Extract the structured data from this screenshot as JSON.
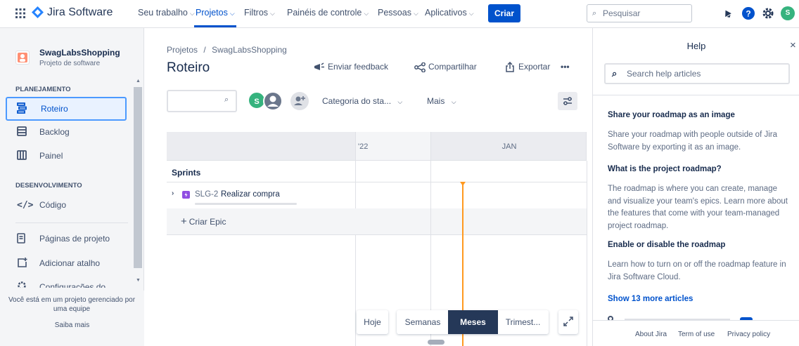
{
  "topnav": {
    "brand": "Jira Software",
    "items": [
      {
        "label": "Seu trabalho"
      },
      {
        "label": "Projetos"
      },
      {
        "label": "Filtros"
      },
      {
        "label": "Painéis de controle"
      },
      {
        "label": "Pessoas"
      },
      {
        "label": "Aplicativos"
      }
    ],
    "create_label": "Criar",
    "search_placeholder": "Pesquisar",
    "avatar_initial": "S",
    "accent": "#0052cc"
  },
  "sidebar": {
    "project_name": "SwagLabsShopping",
    "project_type": "Projeto de software",
    "section_planning": "PLANEJAMENTO",
    "planning_items": [
      {
        "label": "Roteiro",
        "icon": "roadmap-icon",
        "selected": true
      },
      {
        "label": "Backlog",
        "icon": "backlog-icon"
      },
      {
        "label": "Painel",
        "icon": "board-icon"
      }
    ],
    "section_dev": "DESENVOLVIMENTO",
    "dev_items": [
      {
        "label": "Código",
        "icon": "code-icon"
      }
    ],
    "other_items": [
      {
        "label": "Páginas de projeto",
        "icon": "pages-icon"
      },
      {
        "label": "Adicionar atalho",
        "icon": "add-shortcut-icon"
      },
      {
        "label": "Configurações do",
        "icon": "settings-icon"
      }
    ],
    "footer_note": "Você está em um projeto gerenciado por uma equipe",
    "learn_more": "Saiba mais"
  },
  "main": {
    "breadcrumb_root": "Projetos",
    "breadcrumb_sep": "/",
    "breadcrumb_project": "SwagLabsShopping",
    "title": "Roteiro",
    "feedback_label": "Enviar feedback",
    "share_label": "Compartilhar",
    "export_label": "Exportar",
    "more_label": "•••",
    "avatar_initial": "S",
    "status_category": "Categoria do sta...",
    "more_filter": "Mais"
  },
  "roadmap": {
    "timeline_labels": [
      "'22",
      "JAN"
    ],
    "sprints_label": "Sprints",
    "epic_key": "SLG-2",
    "epic_name": "Realizar compra",
    "create_epic": "Criar Epic",
    "today_color": "#ff991f",
    "epic_color": "#904ee2",
    "view_buttons": [
      {
        "label": "Hoje"
      },
      {
        "label": "Semanas"
      },
      {
        "label": "Meses",
        "active": true
      },
      {
        "label": "Trimest..."
      }
    ]
  },
  "help": {
    "title": "Help",
    "search_placeholder": "Search help articles",
    "articles": [
      {
        "heading": "Share your roadmap as an image",
        "body": "Share your roadmap with people outside of Jira Software by exporting it as an image."
      },
      {
        "heading": "What is the project roadmap?",
        "body": "The roadmap is where you can create, manage and visualize your team's epics. Learn more about the features that come with your team-managed project roadmap."
      },
      {
        "heading": "Enable or disable the roadmap",
        "body": "Learn how to turn on or off the roadmap feature in Jira Software Cloud."
      }
    ],
    "show_more": "Show 13 more articles",
    "footer": [
      "About Jira",
      "Term of use",
      "Privacy policy"
    ]
  }
}
